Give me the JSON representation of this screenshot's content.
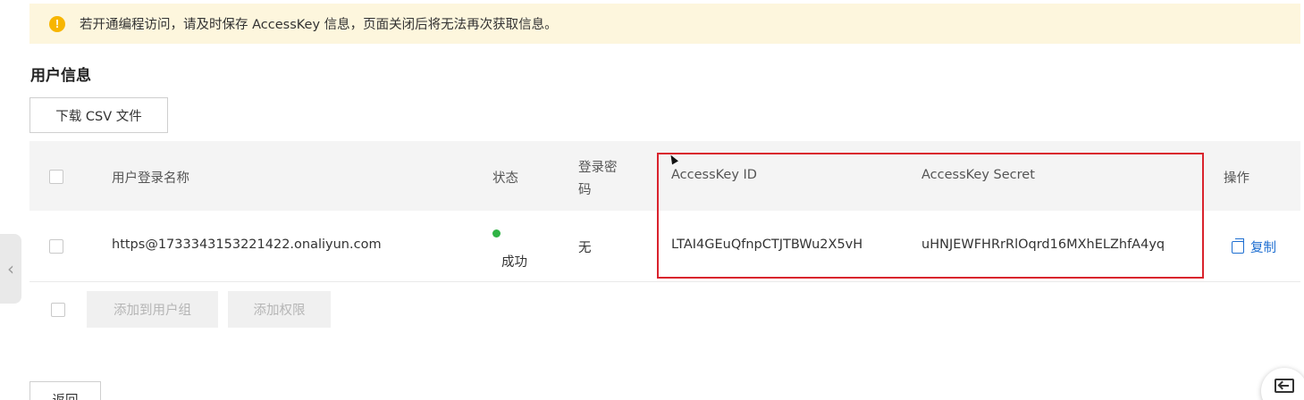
{
  "banner": {
    "icon": "warning-icon",
    "text": "若开通编程访问，请及时保存 AccessKey 信息，页面关闭后将无法再次获取信息。"
  },
  "section": {
    "title": "用户信息"
  },
  "toolbar": {
    "download_csv_label": "下载 CSV 文件"
  },
  "table": {
    "headers": {
      "login_name": "用户登录名称",
      "status": "状态",
      "password_line1": "登录密",
      "password_line2": "码",
      "accesskey_id": "AccessKey ID",
      "accesskey_secret": "AccessKey Secret",
      "actions": "操作"
    },
    "rows": [
      {
        "login_name": "https@1733343153221422.onaliyun.com",
        "status": "成功",
        "status_color": "#2fb344",
        "password": "无",
        "accesskey_id": "LTAI4GEuQfnpCTJTBWu2X5vH",
        "accesskey_secret": "uHNJEWFHRrRlOqrd16MXhELZhfA4yq",
        "action_copy": "复制"
      }
    ]
  },
  "footer_actions": {
    "add_to_group": "添加到用户组",
    "add_permission": "添加权限"
  },
  "back_label": "返回",
  "colors": {
    "banner_bg": "#fdf6dd",
    "warning": "#f7b500",
    "link": "#1f6fd1",
    "highlight": "#d9232d"
  }
}
